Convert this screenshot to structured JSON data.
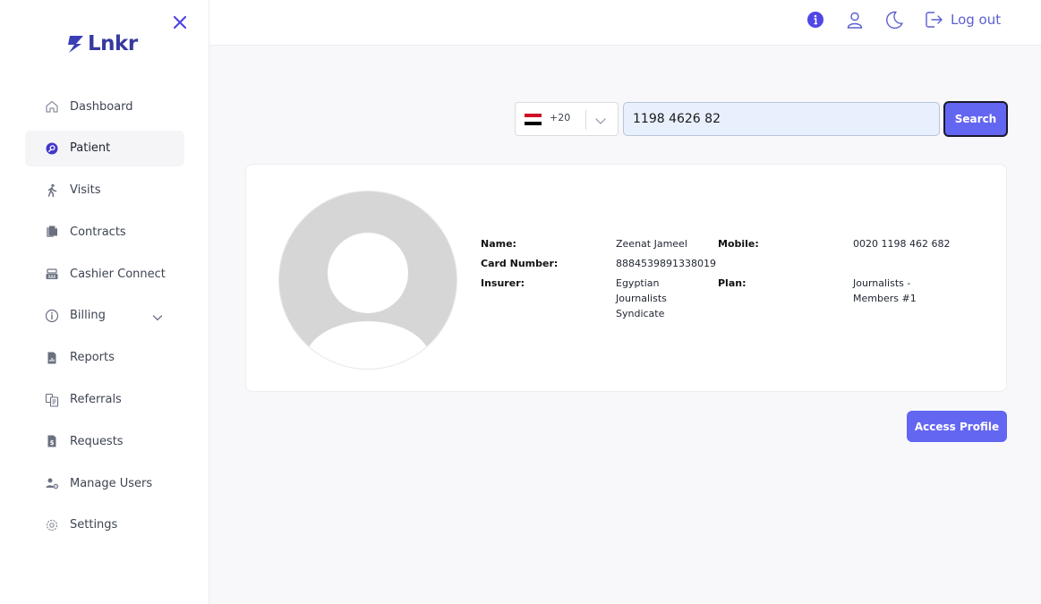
{
  "app": {
    "logo_text": "Lnkr"
  },
  "sidebar": {
    "items": [
      {
        "label": "Dashboard",
        "icon": "home-icon"
      },
      {
        "label": "Patient",
        "icon": "patient-search-icon",
        "active": true
      },
      {
        "label": "Visits",
        "icon": "walking-person-icon"
      },
      {
        "label": "Contracts",
        "icon": "documents-icon"
      },
      {
        "label": "Cashier Connect",
        "icon": "cashier-icon"
      },
      {
        "label": "Billing",
        "icon": "billing-icon",
        "has_submenu": true
      },
      {
        "label": "Reports",
        "icon": "report-icon"
      },
      {
        "label": "Referrals",
        "icon": "referrals-icon"
      },
      {
        "label": "Requests",
        "icon": "requests-icon"
      },
      {
        "label": "Manage Users",
        "icon": "manage-users-icon"
      },
      {
        "label": "Settings",
        "icon": "gear-icon"
      }
    ]
  },
  "header": {
    "logout_label": "Log out"
  },
  "search": {
    "country_code": "+20",
    "country_flag": "egypt-flag-icon",
    "phone_value": "1198 4626 82",
    "button_label": "Search"
  },
  "patient": {
    "name_label": "Name:",
    "name_value": "Zeenat Jameel",
    "card_label": "Card Number:",
    "card_value": "8884539891338019",
    "insurer_label": "Insurer:",
    "insurer_value": "Egyptian Journalists Syndicate",
    "mobile_label": "Mobile:",
    "mobile_value": "0020 1198 462 682",
    "plan_label": "Plan:",
    "plan_value": "Journalists - Members #1"
  },
  "actions": {
    "access_profile_label": "Access Profile"
  },
  "colors": {
    "accent": "#6366f1",
    "brand": "#373a9e",
    "active_bg": "#f5f5f8"
  }
}
